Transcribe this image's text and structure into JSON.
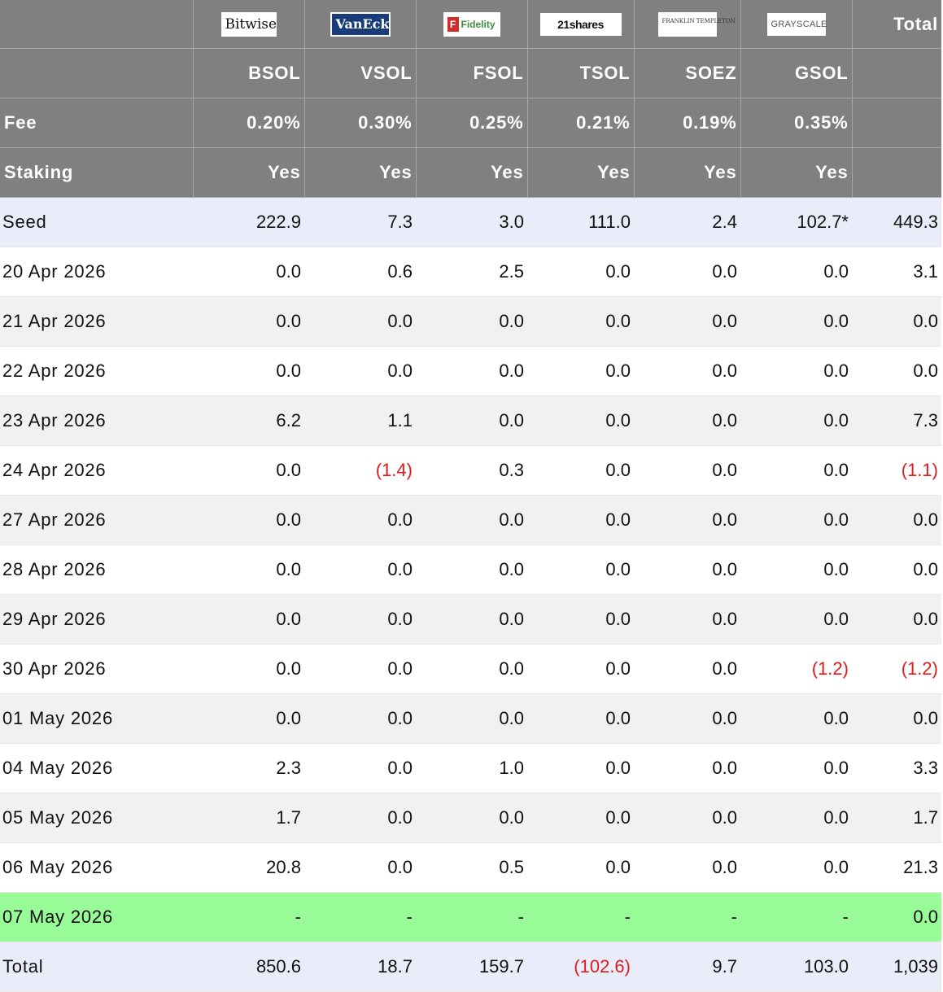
{
  "logos": [
    {
      "name": "bitwise-logo",
      "text": "Bitwise"
    },
    {
      "name": "vaneck-logo",
      "text": "VanEck"
    },
    {
      "name": "fidelity-logo",
      "text": "Fidelity"
    },
    {
      "name": "21shares-logo",
      "text": "21shares"
    },
    {
      "name": "franklin-templeton-logo",
      "text": "FRANKLIN TEMPLETON"
    },
    {
      "name": "grayscale-logo",
      "text": "GRAYSCALE"
    }
  ],
  "header": {
    "total_label": "Total",
    "tickers": [
      "BSOL",
      "VSOL",
      "FSOL",
      "TSOL",
      "SOEZ",
      "GSOL"
    ],
    "fee_label": "Fee",
    "fees": [
      "0.20%",
      "0.30%",
      "0.25%",
      "0.21%",
      "0.19%",
      "0.35%"
    ],
    "staking_label": "Staking",
    "staking": [
      "Yes",
      "Yes",
      "Yes",
      "Yes",
      "Yes",
      "Yes"
    ]
  },
  "rows": [
    {
      "label": "Seed",
      "values": [
        "222.9",
        "7.3",
        "3.0",
        "111.0",
        "2.4",
        "102.7*",
        "449.3"
      ]
    },
    {
      "label": "20 Apr 2026",
      "values": [
        "0.0",
        "0.6",
        "2.5",
        "0.0",
        "0.0",
        "0.0",
        "3.1"
      ]
    },
    {
      "label": "21 Apr 2026",
      "values": [
        "0.0",
        "0.0",
        "0.0",
        "0.0",
        "0.0",
        "0.0",
        "0.0"
      ]
    },
    {
      "label": "22 Apr 2026",
      "values": [
        "0.0",
        "0.0",
        "0.0",
        "0.0",
        "0.0",
        "0.0",
        "0.0"
      ]
    },
    {
      "label": "23 Apr 2026",
      "values": [
        "6.2",
        "1.1",
        "0.0",
        "0.0",
        "0.0",
        "0.0",
        "7.3"
      ]
    },
    {
      "label": "24 Apr 2026",
      "values": [
        "0.0",
        "(1.4)",
        "0.3",
        "0.0",
        "0.0",
        "0.0",
        "(1.1)"
      ]
    },
    {
      "label": "27 Apr 2026",
      "values": [
        "0.0",
        "0.0",
        "0.0",
        "0.0",
        "0.0",
        "0.0",
        "0.0"
      ]
    },
    {
      "label": "28 Apr 2026",
      "values": [
        "0.0",
        "0.0",
        "0.0",
        "0.0",
        "0.0",
        "0.0",
        "0.0"
      ]
    },
    {
      "label": "29 Apr 2026",
      "values": [
        "0.0",
        "0.0",
        "0.0",
        "0.0",
        "0.0",
        "0.0",
        "0.0"
      ]
    },
    {
      "label": "30 Apr 2026",
      "values": [
        "0.0",
        "0.0",
        "0.0",
        "0.0",
        "0.0",
        "(1.2)",
        "(1.2)"
      ]
    },
    {
      "label": "01 May 2026",
      "values": [
        "0.0",
        "0.0",
        "0.0",
        "0.0",
        "0.0",
        "0.0",
        "0.0"
      ]
    },
    {
      "label": "04 May 2026",
      "values": [
        "2.3",
        "0.0",
        "1.0",
        "0.0",
        "0.0",
        "0.0",
        "3.3"
      ]
    },
    {
      "label": "05 May 2026",
      "values": [
        "1.7",
        "0.0",
        "0.0",
        "0.0",
        "0.0",
        "0.0",
        "1.7"
      ]
    },
    {
      "label": "06 May 2026",
      "values": [
        "20.8",
        "0.0",
        "0.5",
        "0.0",
        "0.0",
        "0.0",
        "21.3"
      ]
    },
    {
      "label": "07 May 2026",
      "values": [
        "-",
        "-",
        "-",
        "-",
        "-",
        "-",
        "0.0"
      ]
    },
    {
      "label": "Total",
      "values": [
        "850.6",
        "18.7",
        "159.7",
        "(102.6)",
        "9.7",
        "103.0",
        "1,039"
      ]
    }
  ],
  "colors": {
    "header_bg": "#808080",
    "seed_total_bg": "#e9edf9",
    "highlight_bg": "#98fb98",
    "negative": "#e01b1b"
  }
}
